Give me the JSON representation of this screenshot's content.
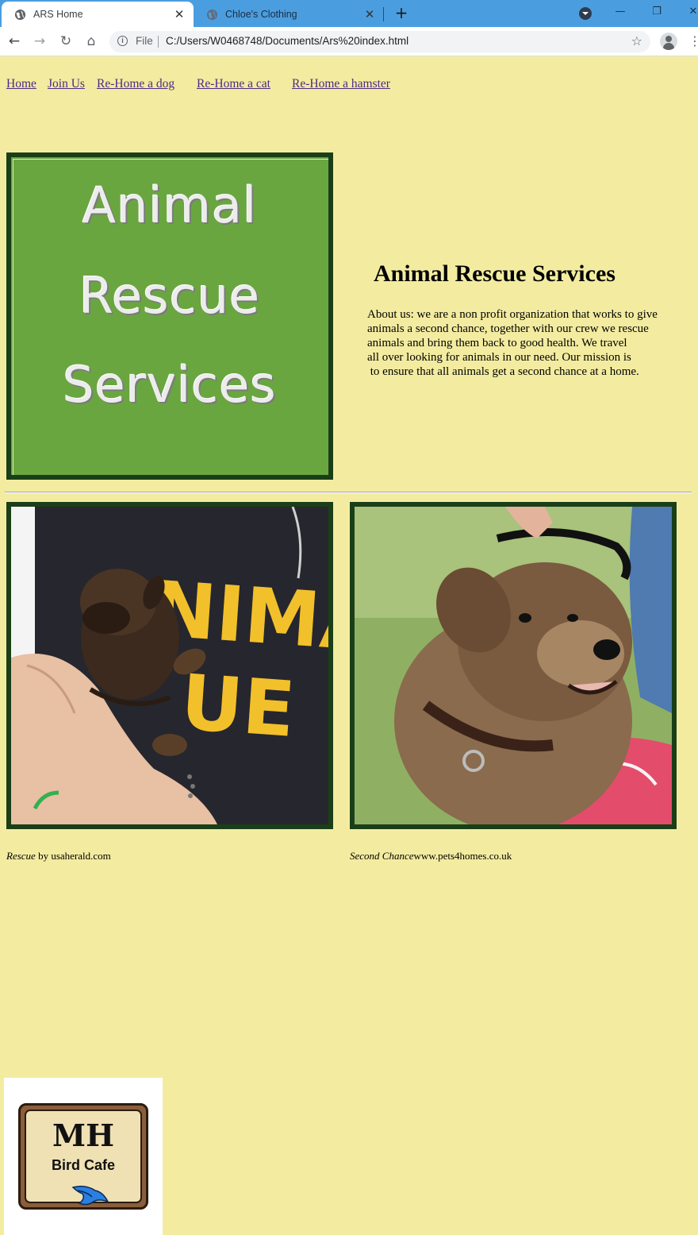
{
  "browser": {
    "tabs": [
      {
        "title": "ARS Home",
        "active": true
      },
      {
        "title": "Chloe's Clothing",
        "active": false
      }
    ],
    "file_label": "File",
    "url": "C:/Users/W0468748/Documents/Ars%20index.html"
  },
  "nav": [
    {
      "label": "Home"
    },
    {
      "label": "Join Us"
    },
    {
      "label": "Re-Home a dog"
    },
    {
      "label": "Re-Home a cat"
    },
    {
      "label": "Re-Home a hamster"
    }
  ],
  "logo": {
    "lines": [
      "Animal",
      "Rescue",
      "Services"
    ],
    "background": "#6aa640"
  },
  "main": {
    "heading": "Animal Rescue Services",
    "about_lines": [
      "About us: we are a non profit organization that works to give",
      "animals a second chance, together with our crew we rescue",
      "animals and bring them back to good health. We travel",
      "all over looking for animals in our need. Our mission is",
      " to ensure that all animals get a second chance at a home."
    ]
  },
  "photos": [
    {
      "caption_title": "Rescue",
      "caption_rest": " by usaherald.com",
      "shirt_text_top": "ANIMAL",
      "shirt_text_bottom": "UE"
    },
    {
      "caption_title": "Second Chance",
      "caption_rest": "www.pets4homes.co.uk"
    }
  ],
  "badge": {
    "mh": "MH",
    "name": "Bird Cafe"
  },
  "colors": {
    "page_bg": "#f3eca0",
    "frame": "#1a3f18",
    "link": "#4e2a84",
    "tab_strip": "#4a9ee0"
  }
}
